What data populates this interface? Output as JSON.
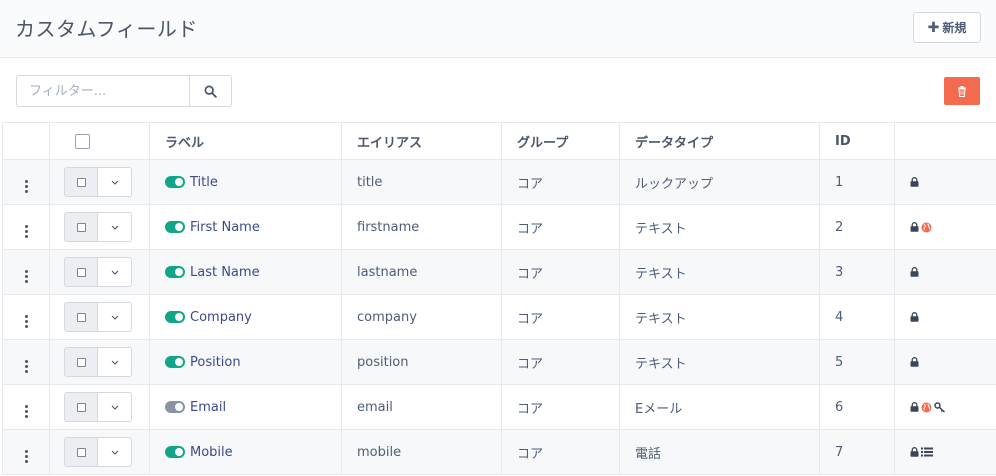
{
  "header": {
    "title": "カスタムフィールド",
    "new_label": "新規"
  },
  "filter": {
    "placeholder": "フィルター..."
  },
  "columns": [
    "ラベル",
    "エイリアス",
    "グループ",
    "データタイプ",
    "ID"
  ],
  "colors": {
    "toggle_on": "#12a689",
    "toggle_off": "#8a93a3",
    "danger": "#f46a4e",
    "globe": "#f46a4e"
  },
  "rows": [
    {
      "label": "Title",
      "alias": "title",
      "group": "コア",
      "type": "ルックアップ",
      "id": "1",
      "published": true,
      "icons": [
        "lock-icon"
      ]
    },
    {
      "label": "First Name",
      "alias": "firstname",
      "group": "コア",
      "type": "テキスト",
      "id": "2",
      "published": true,
      "icons": [
        "lock-icon",
        "globe-icon"
      ]
    },
    {
      "label": "Last Name",
      "alias": "lastname",
      "group": "コア",
      "type": "テキスト",
      "id": "3",
      "published": true,
      "icons": [
        "lock-icon"
      ]
    },
    {
      "label": "Company",
      "alias": "company",
      "group": "コア",
      "type": "テキスト",
      "id": "4",
      "published": true,
      "icons": [
        "lock-icon"
      ]
    },
    {
      "label": "Position",
      "alias": "position",
      "group": "コア",
      "type": "テキスト",
      "id": "5",
      "published": true,
      "icons": [
        "lock-icon"
      ]
    },
    {
      "label": "Email",
      "alias": "email",
      "group": "コア",
      "type": "Eメール",
      "id": "6",
      "published": false,
      "icons": [
        "lock-icon",
        "globe-icon",
        "key-icon"
      ]
    },
    {
      "label": "Mobile",
      "alias": "mobile",
      "group": "コア",
      "type": "電話",
      "id": "7",
      "published": true,
      "icons": [
        "lock-icon",
        "list-icon"
      ]
    }
  ]
}
